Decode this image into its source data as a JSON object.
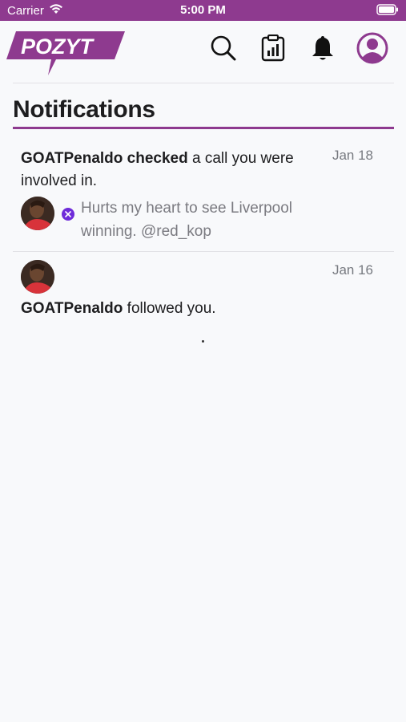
{
  "status_bar": {
    "carrier": "Carrier",
    "time": "5:00 PM"
  },
  "header": {
    "logo_text": "POZYT",
    "icons": [
      "search-icon",
      "clipboard-chart-icon",
      "bell-icon",
      "profile-icon"
    ]
  },
  "page": {
    "title": "Notifications"
  },
  "notifications": [
    {
      "user": "GOATPenaldo",
      "action": "checked",
      "rest": " a call you were involved in.",
      "date": "Jan 18",
      "quote": "Hurts my heart to see Liverpool winning. @red_kop"
    },
    {
      "user": "GOATPenaldo",
      "rest": " followed you.",
      "date": "Jan 16"
    }
  ],
  "colors": {
    "brand": "#8e3a8f",
    "accent": "#6e2bd9",
    "background": "#f8f9fb",
    "muted_text": "#7a7a80"
  }
}
